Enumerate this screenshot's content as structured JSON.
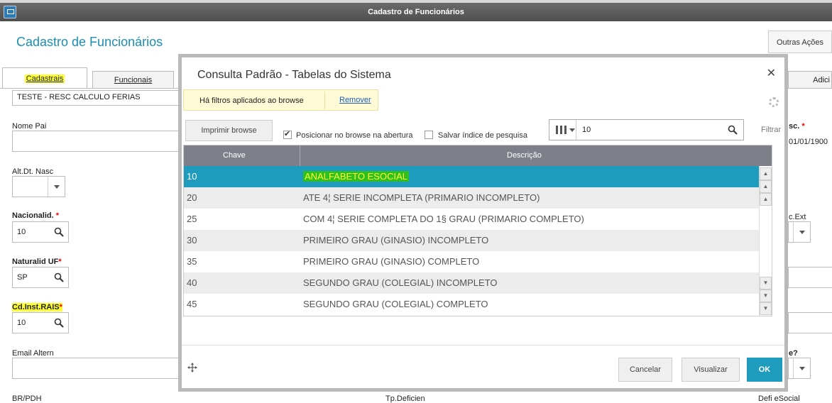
{
  "window": {
    "title": "Cadastro de Funcionários"
  },
  "page": {
    "title": "Cadastro de Funcionários",
    "other_actions": "Outras Ações"
  },
  "tabs": [
    {
      "label": "Cadastrais"
    },
    {
      "label": "Funcionais"
    },
    {
      "label": "Adici"
    }
  ],
  "form": {
    "name_value": "TESTE - RESC CALCULO FERIAS",
    "nome_pai_label": "Nome Pai",
    "alt_dt_nasc_label": "Alt.Dt. Nasc",
    "nacionalid_label": "Nacionalid.",
    "nacionalid_value": "10",
    "naturalid_label": "Naturalid UF",
    "naturalid_value": "SP",
    "cd_inst_label": "Cd.Inst.RAIS",
    "cd_inst_value": "10",
    "email_label": "Email Altern",
    "br_pdh_label": "BR/PDH",
    "tp_deficien_label": "Tp.Deficien",
    "defi_esocial_label": "Defi eSocial",
    "sc_label": "sc.",
    "date_value": "01/01/1900",
    "c_ext_label": "c.Ext",
    "e_label": "e?"
  },
  "modal": {
    "title": "Consulta Padrão - Tabelas do Sistema",
    "filter_notice": "Há filtros aplicados ao browse",
    "filter_remove": "Remover",
    "print_button": "Imprimir browse",
    "position_checkbox": "Posicionar no browse na abertura",
    "save_index_checkbox": "Salvar índice de pesquisa",
    "search_value": "10",
    "filter_label": "Filtrar",
    "columns": [
      "Chave",
      "Descrição"
    ],
    "rows": [
      {
        "key": "10",
        "desc": "ANALFABETO  ESOCIAL"
      },
      {
        "key": "20",
        "desc": "ATE 4¦ SERIE INCOMPLETA (PRIMARIO INCOMPLETO)"
      },
      {
        "key": "25",
        "desc": "COM 4¦ SERIE COMPLETA DO 1§ GRAU (PRIMARIO COMPLETO)"
      },
      {
        "key": "30",
        "desc": "PRIMEIRO GRAU (GINASIO) INCOMPLETO"
      },
      {
        "key": "35",
        "desc": "PRIMEIRO GRAU (GINASIO) COMPLETO"
      },
      {
        "key": "40",
        "desc": "SEGUNDO GRAU (COLEGIAL) INCOMPLETO"
      },
      {
        "key": "45",
        "desc": "SEGUNDO GRAU (COLEGIAL) COMPLETO"
      }
    ],
    "cancel_button": "Cancelar",
    "view_button": "Visualizar",
    "ok_button": "OK"
  },
  "colors": {
    "accent": "#1e9bbd",
    "highlight": "#ffff33",
    "header_gray": "#7d8088"
  }
}
